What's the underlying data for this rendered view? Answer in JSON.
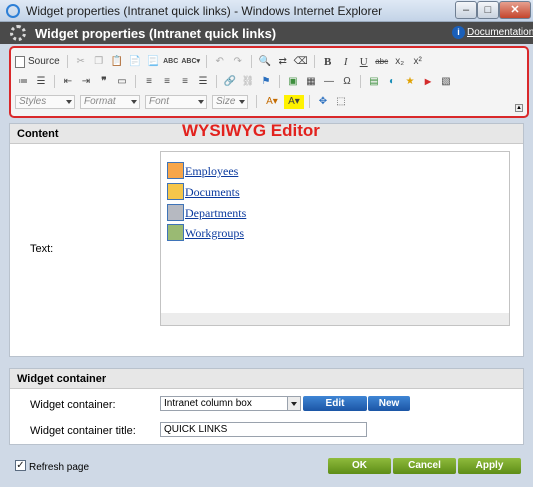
{
  "window": {
    "title": "Widget properties (Intranet quick links) - Windows Internet Explorer",
    "controls": {
      "minimize": "–",
      "maximize": "□",
      "close": "✕"
    }
  },
  "header": {
    "title": "Widget properties (Intranet quick links)",
    "documentation_label": "Documentation",
    "documentation_icon": "i"
  },
  "toolbar": {
    "source_label": "Source",
    "row1": [
      "cut-icon",
      "copy-icon",
      "paste-icon",
      "paste-text-icon",
      "paste-word-icon",
      "spellcheck-icon",
      "spellcheck-options-icon",
      "undo-icon",
      "redo-icon",
      "find-icon",
      "replace-icon",
      "remove-format-icon",
      "bold-icon",
      "italic-icon",
      "underline-icon",
      "strikethrough-icon",
      "subscript-icon",
      "superscript-icon"
    ],
    "row1_glyphs": {
      "bold": "B",
      "italic": "I",
      "underline": "U",
      "strike": "abc",
      "sub": "x₂",
      "sup": "x²",
      "spell": "ABC",
      "spell2": "ABC▾"
    },
    "format_combos": {
      "styles": "Styles",
      "format": "Format",
      "font": "Font",
      "size": "Size"
    }
  },
  "annotation": {
    "wysiwyg_label": "WYSIWYG Editor"
  },
  "content_panel": {
    "heading": "Content",
    "text_label": "Text:",
    "links": [
      {
        "label": "Employees",
        "icon": "people-icon"
      },
      {
        "label": "Documents",
        "icon": "folder-icon"
      },
      {
        "label": "Departments",
        "icon": "cube-icon"
      },
      {
        "label": "Workgroups",
        "icon": "group-icon"
      }
    ]
  },
  "container_panel": {
    "heading": "Widget container",
    "container_label": "Widget container:",
    "container_value": "Intranet column box",
    "edit_label": "Edit",
    "new_label": "New",
    "title_label": "Widget container title:",
    "title_value": "QUICK LINKS"
  },
  "footer": {
    "refresh_label": "Refresh page",
    "refresh_checked": true,
    "check_glyph": "✓",
    "ok_label": "OK",
    "cancel_label": "Cancel",
    "apply_label": "Apply"
  },
  "colors": {
    "accent_red": "#e2221e",
    "link_blue": "#0b3a9e",
    "button_blue": "#1b55a5",
    "button_green": "#5d8d17",
    "header_dark": "#4a4a4a"
  }
}
